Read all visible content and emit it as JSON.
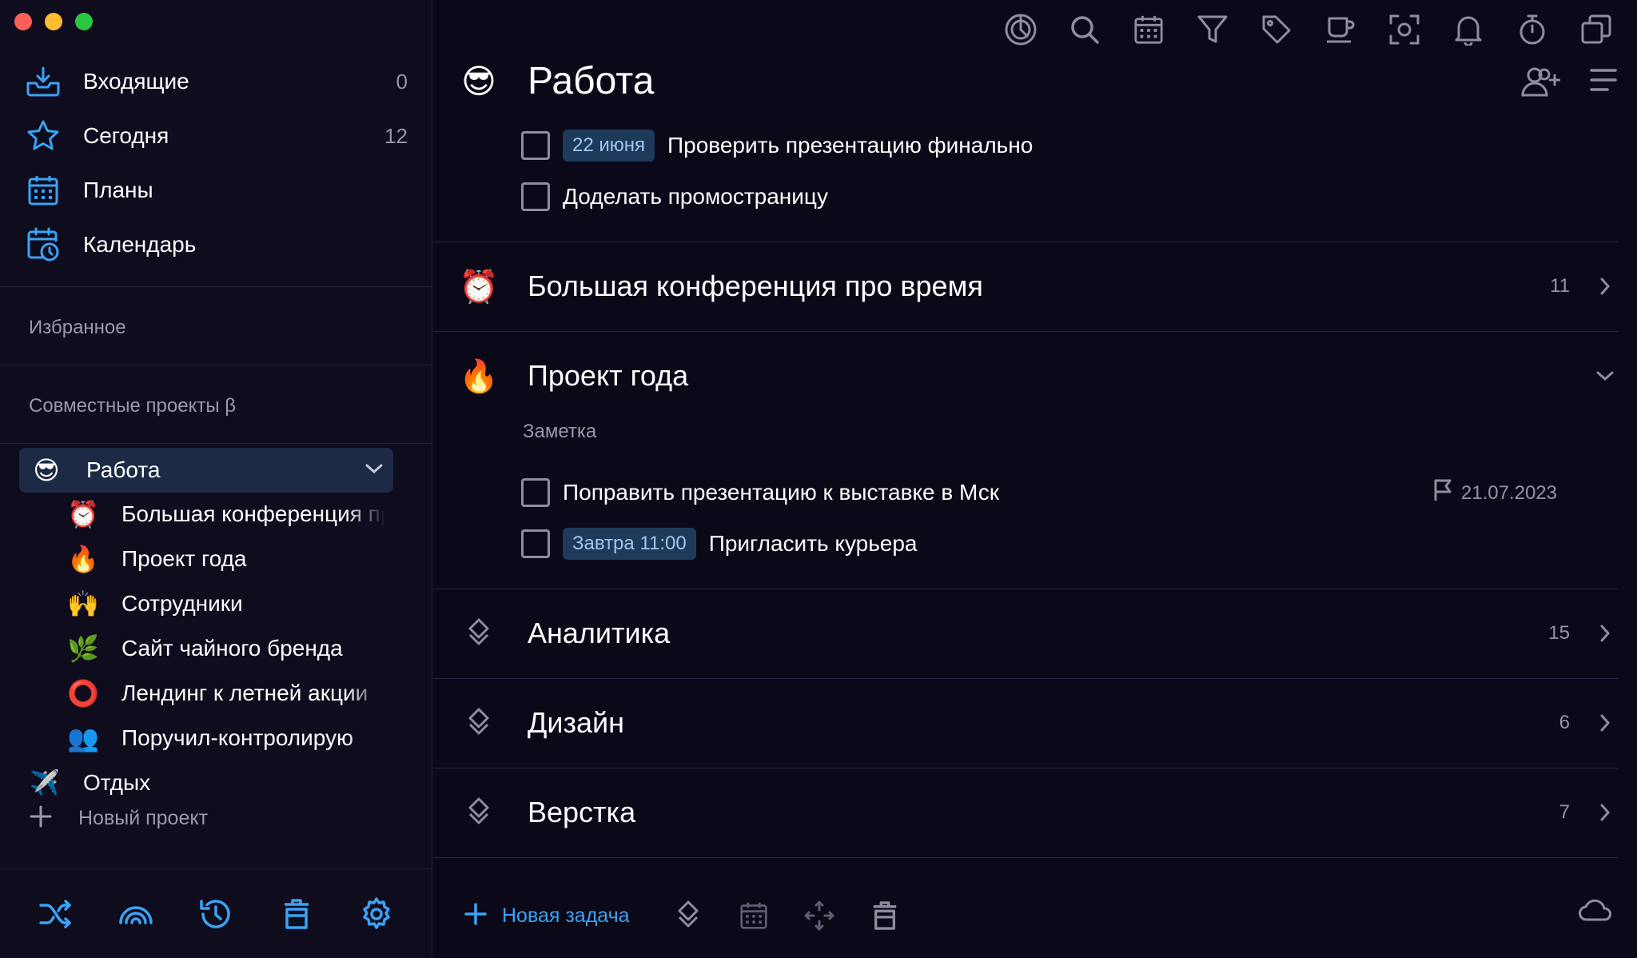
{
  "colors": {
    "accent": "#3aa3f5",
    "muted": "#9693a8",
    "pill_bg": "#1e3a5b",
    "active_bg": "#1d2a45"
  },
  "sidebar": {
    "nav": [
      {
        "label": "Входящие",
        "count": "0",
        "icon": "inbox-icon"
      },
      {
        "label": "Сегодня",
        "count": "12",
        "icon": "star-icon"
      },
      {
        "label": "Планы",
        "count": "",
        "icon": "calendar-grid-icon"
      },
      {
        "label": "Календарь",
        "count": "",
        "icon": "calendar-clock-icon"
      }
    ],
    "favorites_label": "Избранное",
    "shared_label": "Совместные проекты β",
    "active_project": {
      "emoji": "😎",
      "label": "Работа"
    },
    "subprojects": [
      {
        "emoji": "⏰",
        "label": "Большая конференция про время"
      },
      {
        "emoji": "🔥",
        "label": "Проект года"
      },
      {
        "emoji": "🙌",
        "label": "Сотрудники"
      },
      {
        "emoji": "🌿",
        "label": "Сайт чайного бренда"
      },
      {
        "emoji": "⭕",
        "label": "Лендинг к летней акции"
      },
      {
        "emoji": "👥",
        "label": "Поручил-контролирую"
      }
    ],
    "other_project": {
      "emoji": "✈️",
      "label": "Отдых"
    },
    "new_project_label": "Новый проект",
    "footer_icons": [
      "shuffle-icon",
      "rainbow-icon",
      "history-icon",
      "trash-icon",
      "gear-icon"
    ]
  },
  "toolbar_icons": [
    "focus-icon",
    "search-icon",
    "calendar-icon",
    "filter-icon",
    "tag-icon",
    "coffee-icon",
    "scan-icon",
    "bell-icon",
    "timer-icon",
    "windows-icon"
  ],
  "main": {
    "title_emoji": "😎",
    "title": "Работа",
    "tasks_top": [
      {
        "pill": "22 июня",
        "text": "Проверить презентацию финально"
      },
      {
        "pill": "",
        "text": "Доделать промостраницу"
      }
    ],
    "sections": [
      {
        "emoji": "⏰",
        "title": "Большая конференция про время",
        "count": "11"
      },
      {
        "emoji": "🔥",
        "title": "Проект года",
        "count": ""
      },
      {
        "emoji": "",
        "title": "Аналитика",
        "count": "15"
      },
      {
        "emoji": "",
        "title": "Дизайн",
        "count": "6"
      },
      {
        "emoji": "",
        "title": "Верстка",
        "count": "7"
      }
    ],
    "note_label": "Заметка",
    "tasks_project": [
      {
        "pill": "",
        "text": "Поправить презентацию к выставке в Мск",
        "due": "21.07.2023"
      },
      {
        "pill": "Завтра 11:00",
        "text": "Пригласить курьера",
        "due": ""
      }
    ],
    "new_task_label": "Новая задача"
  }
}
